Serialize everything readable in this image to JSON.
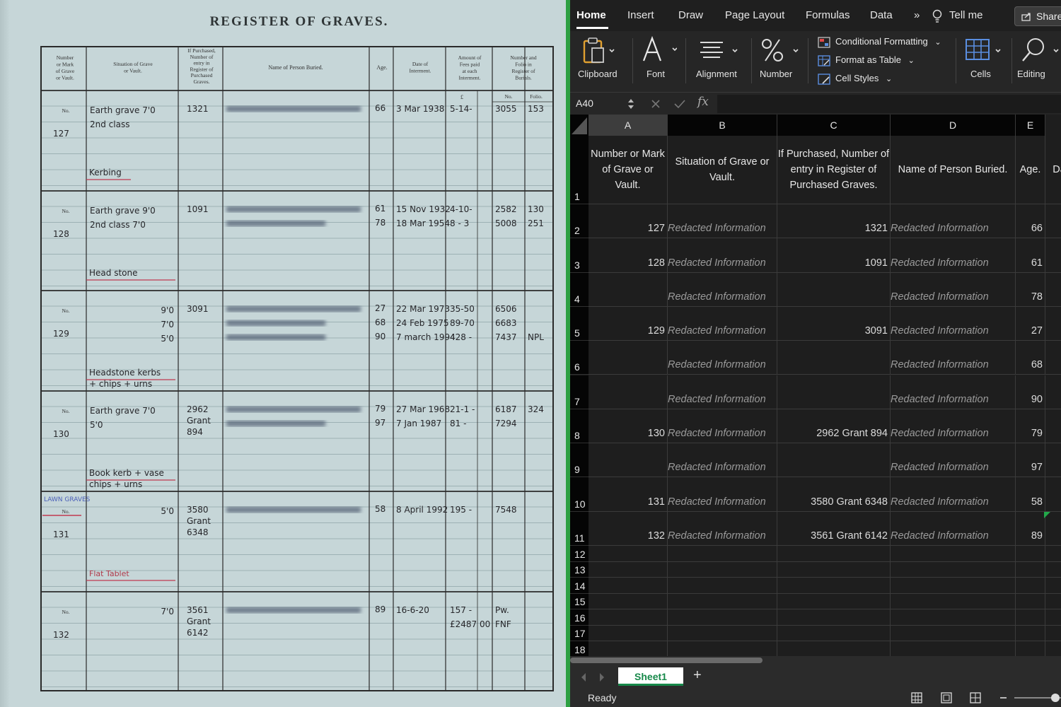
{
  "scan": {
    "title": "REGISTER OF GRAVES.",
    "headers": {
      "number": [
        "Number",
        "or Mark",
        "of Grave",
        "or Vault."
      ],
      "situation": [
        "Situation of Grave",
        "or Vault."
      ],
      "purchased": [
        "If Purchased,",
        "Number of",
        "entry in",
        "Register of",
        "Purchased",
        "Graves."
      ],
      "name": "Name of Person Buried.",
      "age": "Age.",
      "date": [
        "Date of",
        "Interment."
      ],
      "amount": [
        "Amount of",
        "Fees paid",
        "at each",
        "Interment."
      ],
      "folio": [
        "Number and",
        "Folio in",
        "Register of",
        "Burials."
      ],
      "pound": "£",
      "no": "No.",
      "foliolbl": "Folio."
    },
    "no_label": "No.",
    "rows": [
      {
        "number": "127",
        "situation": [
          "Earth grave 7'0",
          "2nd class"
        ],
        "note": "Kerbing",
        "purchased": [
          "1321"
        ],
        "ages": [
          "66"
        ],
        "dates": [
          "3 Mar 1938"
        ],
        "fees": [
          "5-14-"
        ],
        "reg_no": [
          "3055"
        ],
        "folio": [
          "153"
        ]
      },
      {
        "number": "128",
        "situation": [
          "Earth grave 9'0",
          "2nd class  7'0"
        ],
        "note": "Head stone",
        "purchased": [
          "1091"
        ],
        "ages": [
          "61",
          "78"
        ],
        "dates": [
          "15 Nov 1932",
          "18 Mar 1954"
        ],
        "fees": [
          "4-10-",
          "8 - 3"
        ],
        "reg_no": [
          "2582",
          "5008"
        ],
        "folio": [
          "130",
          "251"
        ]
      },
      {
        "number": "129",
        "situation": [
          "9'0",
          "7'0",
          "5'0"
        ],
        "note": "Headstone kerbs",
        "note2": "+ chips + urns",
        "purchased": [
          "3091"
        ],
        "ages": [
          "27",
          "68",
          "90"
        ],
        "dates": [
          "22 Mar 1973",
          "24 Feb 1975",
          "7 march 1994"
        ],
        "fees": [
          "35-50",
          "89-70",
          "428 -"
        ],
        "reg_no": [
          "6506",
          "6683",
          "7437"
        ],
        "folio": [
          "",
          "",
          "NPL"
        ]
      },
      {
        "number": "130",
        "situation": [
          "Earth grave 7'0",
          "5'0"
        ],
        "note": "Book kerb + vase",
        "note2": "chips + urns",
        "purchased": [
          "2962",
          "Grant",
          "894"
        ],
        "ages": [
          "79",
          "97"
        ],
        "dates": [
          "27 Mar 1968",
          "7 Jan 1987"
        ],
        "fees": [
          "21-1 -",
          "81 -"
        ],
        "reg_no": [
          "6187",
          "7294"
        ],
        "folio": [
          "324",
          ""
        ]
      },
      {
        "number": "131",
        "lawn": "LAWN GRAVES",
        "situation": [
          "5'0"
        ],
        "note": "Flat Tablet",
        "purchased": [
          "3580",
          "Grant",
          "6348"
        ],
        "ages": [
          "58"
        ],
        "dates": [
          "8 April 1992"
        ],
        "fees": [
          "195 -"
        ],
        "reg_no": [
          "7548"
        ],
        "folio": [
          ""
        ]
      },
      {
        "number": "132",
        "situation": [
          "7'0"
        ],
        "note": "",
        "purchased": [
          "3561",
          "Grant",
          "6142"
        ],
        "ages": [
          "89"
        ],
        "dates": [
          "16-6-20"
        ],
        "fees": [
          "157 -",
          "£2487 00"
        ],
        "reg_no": [
          "Pw.",
          "FNF"
        ],
        "folio": [
          ""
        ]
      }
    ]
  },
  "excel": {
    "menu": {
      "tabs": [
        "Home",
        "Insert",
        "Draw",
        "Page Layout",
        "Formulas",
        "Data"
      ],
      "more": "»",
      "tell_me": "Tell me",
      "share": "Share"
    },
    "ribbon": {
      "clipboard": "Clipboard",
      "font": "Font",
      "alignment": "Alignment",
      "number": "Number",
      "conditional_formatting": "Conditional Formatting",
      "format_as_table": "Format as Table",
      "cell_styles": "Cell Styles",
      "cells": "Cells",
      "editing": "Editing"
    },
    "formula_bar": {
      "name_box": "A40",
      "fx": "fx",
      "value": ""
    },
    "columns": [
      "A",
      "B",
      "C",
      "D",
      "E"
    ],
    "header_row": {
      "A": "Number or Mark of Grave or Vault.",
      "B": "Situation of Grave or Vault.",
      "C": "If Purchased, Number of entry in Register of Purchased Graves.",
      "D": "Name of Person Buried.",
      "E": "Age.",
      "F": "Da"
    },
    "rows": [
      {
        "n": "2",
        "A": "127",
        "B": "Redacted Information",
        "C": "1321",
        "D": "Redacted Information",
        "E": "66"
      },
      {
        "n": "3",
        "A": "128",
        "B": "Redacted Information",
        "C": "1091",
        "D": "Redacted Information",
        "E": "61"
      },
      {
        "n": "4",
        "A": "",
        "B": "Redacted Information",
        "C": "",
        "D": "Redacted Information",
        "E": "78"
      },
      {
        "n": "5",
        "A": "129",
        "B": "Redacted Information",
        "C": "3091",
        "D": "Redacted Information",
        "E": "27"
      },
      {
        "n": "6",
        "A": "",
        "B": "Redacted Information",
        "C": "",
        "D": "Redacted Information",
        "E": "68"
      },
      {
        "n": "7",
        "A": "",
        "B": "Redacted Information",
        "C": "",
        "D": "Redacted Information",
        "E": "90"
      },
      {
        "n": "8",
        "A": "130",
        "B": "Redacted Information",
        "C": "2962 Grant 894",
        "D": "Redacted Information",
        "E": "79"
      },
      {
        "n": "9",
        "A": "",
        "B": "Redacted Information",
        "C": "",
        "D": "Redacted Information",
        "E": "97"
      },
      {
        "n": "10",
        "A": "131",
        "B": "Redacted Information",
        "C": "3580 Grant 6348",
        "D": "Redacted Information",
        "E": "58"
      },
      {
        "n": "11",
        "A": "132",
        "B": "Redacted Information",
        "C": "3561 Grant 6142",
        "D": "Redacted Information",
        "E": "89"
      }
    ],
    "empty_rows": [
      "12",
      "13",
      "14",
      "15",
      "16",
      "17",
      "18"
    ],
    "header_row_number": "1",
    "sheet_tab": "Sheet1",
    "add_sheet": "+",
    "status": "Ready"
  }
}
